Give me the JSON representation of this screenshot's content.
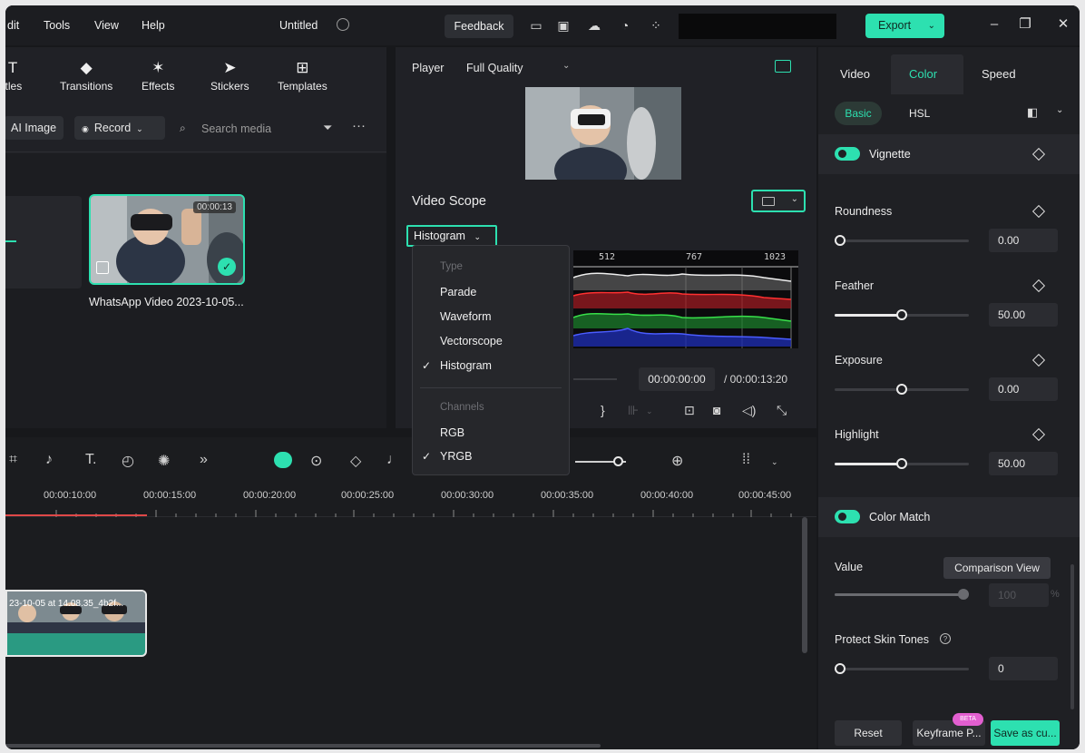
{
  "menu": [
    "dit",
    "Tools",
    "View",
    "Help"
  ],
  "document_title": "Untitled",
  "feedback_label": "Feedback",
  "export_label": "Export",
  "media_tabs": [
    {
      "icon": "text-icon",
      "label": "Titles"
    },
    {
      "icon": "transitions-icon",
      "label": "Transitions"
    },
    {
      "icon": "effects-icon",
      "label": "Effects"
    },
    {
      "icon": "stickers-icon",
      "label": "Stickers"
    },
    {
      "icon": "templates-icon",
      "label": "Templates"
    }
  ],
  "media_toolbar": {
    "ai_image_label": "AI Image",
    "record_label": "Record",
    "search_placeholder": "Search media"
  },
  "media_item": {
    "duration": "00:00:13",
    "name": "WhatsApp Video 2023-10-05..."
  },
  "player": {
    "label": "Player",
    "quality": "Full Quality",
    "current_time": "00:00:00:00",
    "total_time": "/ 00:00:13:20"
  },
  "video_scope": {
    "title": "Video Scope",
    "selected_type": "Histogram",
    "scale_labels": [
      "512",
      "767",
      "1023"
    ]
  },
  "scope_dropdown": {
    "type_header": "Type",
    "types": [
      "Parade",
      "Waveform",
      "Vectorscope",
      "Histogram"
    ],
    "checked_type": "Histogram",
    "channels_header": "Channels",
    "channels": [
      "RGB",
      "YRGB"
    ],
    "checked_channel": "YRGB"
  },
  "timeline": {
    "ruler_labels": [
      "00:00:10:00",
      "00:00:15:00",
      "00:00:20:00",
      "00:00:25:00",
      "00:00:30:00",
      "00:00:35:00",
      "00:00:40:00",
      "00:00:45:00"
    ],
    "clip_name": "23-10-05 at 14.08.35_4b2f..."
  },
  "right_panel": {
    "tabs": [
      "Video",
      "Color",
      "Speed"
    ],
    "active_tab": "Color",
    "sub_tabs": [
      "Basic",
      "HSL"
    ],
    "vignette": {
      "title": "Vignette",
      "params": [
        {
          "label": "Roundness",
          "value": "0.00",
          "fraction": 0.0
        },
        {
          "label": "Feather",
          "value": "50.00",
          "fraction": 0.5
        },
        {
          "label": "Exposure",
          "value": "0.00",
          "fraction": 0.5
        },
        {
          "label": "Highlight",
          "value": "50.00",
          "fraction": 0.5
        }
      ]
    },
    "color_match": {
      "title": "Color Match",
      "value_label": "Value",
      "comparison_label": "Comparison View",
      "value": "100",
      "value_unit": "%",
      "value_fraction": 1.0,
      "protect_label": "Protect Skin Tones",
      "protect_value": "0",
      "protect_fraction": 0.0
    },
    "reset_label": "Reset",
    "keyframe_label": "Keyframe P...",
    "beta_label": "BETA",
    "save_label": "Save as cu..."
  },
  "colors": {
    "accent": "#2de0b0",
    "background": "#17181b"
  }
}
